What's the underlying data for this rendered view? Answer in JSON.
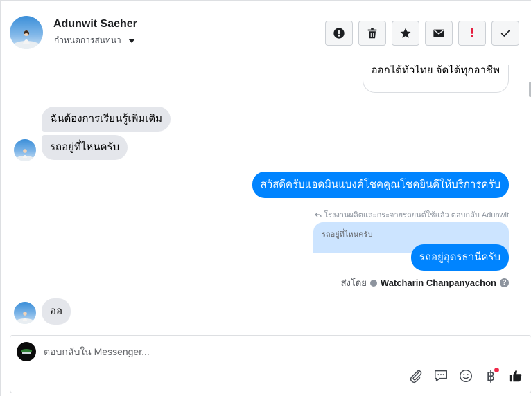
{
  "header": {
    "contact_name": "Adunwit Saeher",
    "assign_label": "กำหนดการสนทนา",
    "actions": [
      {
        "icon": "alert-circle-icon",
        "name": "mark-spam-button"
      },
      {
        "icon": "trash-icon",
        "name": "delete-button"
      },
      {
        "icon": "star-icon",
        "name": "star-button"
      },
      {
        "icon": "envelope-icon",
        "name": "mark-unread-button"
      },
      {
        "icon": "exclamation-icon",
        "name": "follow-up-button",
        "label": "!"
      },
      {
        "icon": "checkmark-icon",
        "name": "mark-done-button"
      }
    ]
  },
  "messages": [
    {
      "id": "m1",
      "direction": "outgoing-outline",
      "text": "ออกได้ทั่วไทย จัดได้ทุกอาชีพ"
    },
    {
      "id": "m2",
      "direction": "incoming",
      "text": "ฉันต้องการเรียนรู้เพิ่มเติม"
    },
    {
      "id": "m3",
      "direction": "incoming",
      "text": "รถอยู่ที่ไหนครับ"
    },
    {
      "id": "m4",
      "direction": "outgoing",
      "text": "สวัสดีครับแอดมินแบงค์โชคคูณโชคยินดีให้บริการครับ"
    },
    {
      "id": "m5",
      "direction": "outgoing",
      "text": "รถอยู่อุดรธานีครับ"
    },
    {
      "id": "m6",
      "direction": "incoming",
      "text": "ออ"
    }
  ],
  "reply_context": {
    "meta": "โรงงานผลิตและกระจายรถยนต์ใช้แล้ว ตอบกลับ Adunwit",
    "quoted_text": "รถอยู่ที่ไหนครับ"
  },
  "sent_by": {
    "prefix": "ส่งโดย",
    "name": "Watcharin Chanpanyachon",
    "help": "?"
  },
  "composer": {
    "placeholder": "ตอบกลับใน Messenger...",
    "tools": [
      "paperclip-icon",
      "saved-reply-icon",
      "emoji-icon",
      "baht-payment-icon",
      "thumbs-up-icon"
    ],
    "baht_symbol": "฿"
  },
  "colors": {
    "outgoing": "#0084ff",
    "incoming": "#e4e6eb",
    "quoted": "#cce4ff",
    "notification_dot": "#f02849"
  }
}
